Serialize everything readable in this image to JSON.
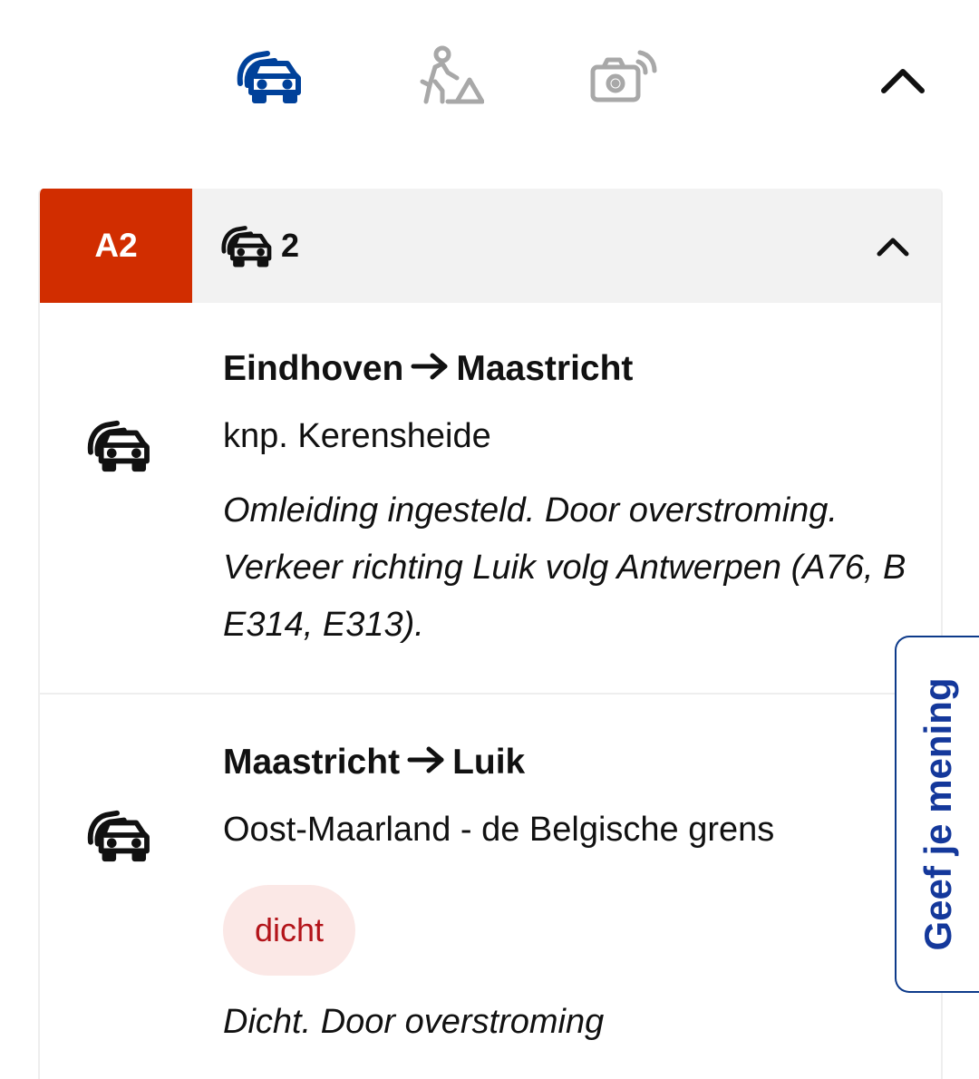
{
  "filters": {
    "tabs": [
      {
        "icon": "traffic-jam-icon",
        "active": true
      },
      {
        "icon": "roadworks-icon",
        "active": false
      },
      {
        "icon": "speed-camera-icon",
        "active": false
      }
    ],
    "collapse_icon": "chevron-up-icon"
  },
  "colors": {
    "active_blue": "#00419a",
    "inactive_gray": "#a8a8a8",
    "road_badge": "#d12d00",
    "closed_bg": "#fbe8e6",
    "closed_text": "#b3141a",
    "feedback": "#14389b"
  },
  "road": {
    "name": "A2",
    "jam_count": "2",
    "events": [
      {
        "icon": "traffic-jam-icon",
        "from": "Eindhoven",
        "to": "Maastricht",
        "location": "knp. Kerensheide",
        "description": "Omleiding ingesteld. Door overstroming. Verkeer richting Luik volg Antwerpen (A76, B E314, E313)."
      },
      {
        "icon": "traffic-jam-icon",
        "from": "Maastricht",
        "to": "Luik",
        "location": "Oost-Maarland - de Belgische grens",
        "status": "dicht",
        "description": "Dicht. Door overstroming"
      }
    ]
  },
  "feedback": {
    "label": "Geef je mening"
  }
}
